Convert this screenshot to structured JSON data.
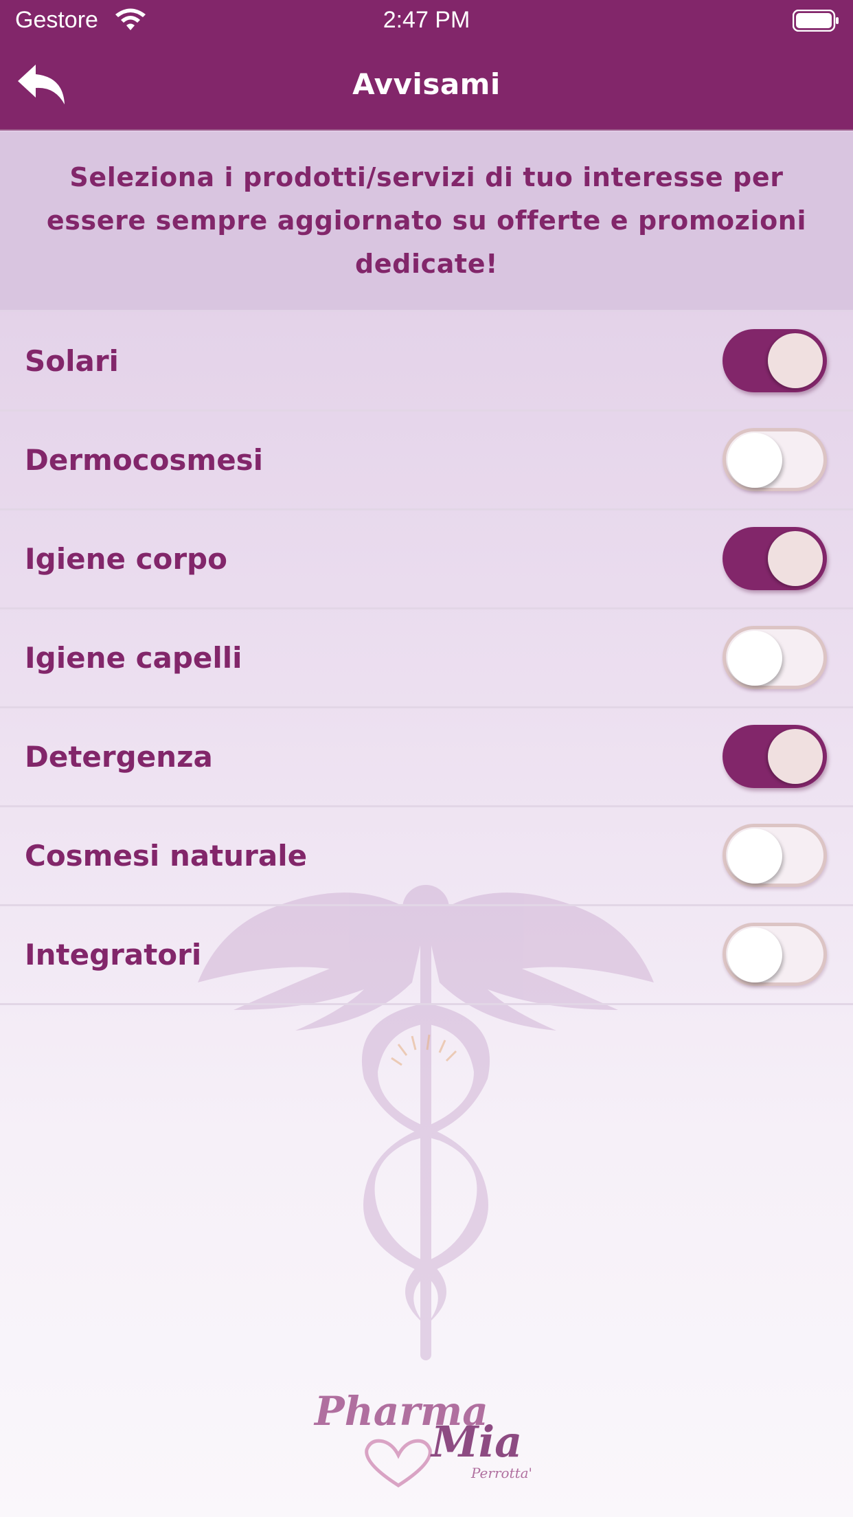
{
  "status_bar": {
    "carrier": "Gestore",
    "time": "2:47 PM"
  },
  "nav": {
    "title": "Avvisami",
    "back_icon": "back-arrow-icon"
  },
  "intro": {
    "text": "Seleziona i prodotti/servizi di tuo interesse per essere sempre aggiornato su offerte e promozioni dedicate!"
  },
  "categories": [
    {
      "label": "Solari",
      "enabled": true
    },
    {
      "label": "Dermocosmesi",
      "enabled": false
    },
    {
      "label": "Igiene corpo",
      "enabled": true
    },
    {
      "label": "Igiene capelli",
      "enabled": false
    },
    {
      "label": "Detergenza",
      "enabled": true
    },
    {
      "label": "Cosmesi naturale",
      "enabled": false
    },
    {
      "label": "Integratori",
      "enabled": false
    }
  ],
  "logo": {
    "line1": "Pharma",
    "line2": "Mia",
    "line3": "Perrotta'"
  },
  "colors": {
    "primary": "#82266a",
    "toggle_knob_on": "#f0e0e0",
    "toggle_off_border": "#dcc4c4"
  }
}
